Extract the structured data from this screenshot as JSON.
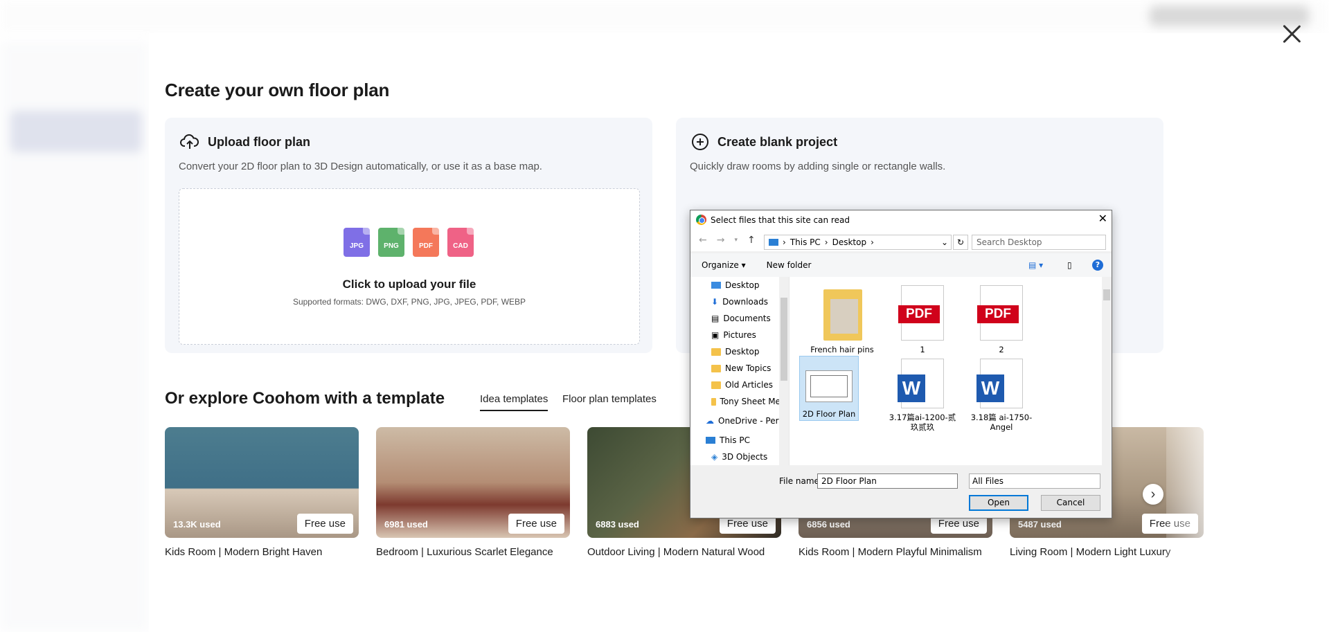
{
  "modal": {
    "title": "Create your own floor plan",
    "upload": {
      "heading": "Upload floor plan",
      "description": "Convert your 2D floor plan to 3D Design automatically, or use it as a base map.",
      "file_types": [
        "JPG",
        "PNG",
        "PDF",
        "CAD"
      ],
      "file_colors": [
        "#7f6fe6",
        "#5eb26c",
        "#f4785a",
        "#ef6286"
      ],
      "cta": "Click to upload your file",
      "formats": "Supported formats: DWG, DXF, PNG, JPG, JPEG, PDF, WEBP"
    },
    "blank": {
      "heading": "Create blank project",
      "description": "Quickly draw rooms by adding single or rectangle walls."
    },
    "explore": {
      "title": "Or explore Coohom with a template",
      "tabs": [
        "Idea templates",
        "Floor plan templates"
      ],
      "free_label": "Free use",
      "templates": [
        {
          "used": "13.3K used",
          "name": "Kids Room | Modern Bright Haven",
          "color": "#4d7d8f"
        },
        {
          "used": "6981 used",
          "name": "Bedroom | Luxurious Scarlet Elegance",
          "color": "#b48d74"
        },
        {
          "used": "6883 used",
          "name": "Outdoor Living | Modern Natural Wood",
          "color": "#5b6446"
        },
        {
          "used": "6856 used",
          "name": "Kids Room | Modern Playful Minimalism",
          "color": "#9a8b7c"
        },
        {
          "used": "5487 used",
          "name": "Living Room | Modern Light Luxury",
          "color": "#a89680"
        }
      ]
    }
  },
  "dialog": {
    "title": "Select files that this site can read",
    "breadcrumb": [
      "This PC",
      "Desktop"
    ],
    "search_placeholder": "Search Desktop",
    "organize": "Organize ▾",
    "new_folder": "New folder",
    "tree": [
      "Desktop",
      "Downloads",
      "Documents",
      "Pictures",
      "Desktop",
      "New Topics",
      "Old Articles",
      "Tony Sheet Meta",
      "OneDrive - Person",
      "This PC",
      "3D Objects"
    ],
    "files": [
      {
        "name": "French hair pins images",
        "kind": "folder"
      },
      {
        "name": "1",
        "kind": "pdf"
      },
      {
        "name": "2",
        "kind": "pdf"
      },
      {
        "name": "2D Floor Plan",
        "kind": "image"
      },
      {
        "name": "3.17篇ai-1200-贰玖贰玖",
        "kind": "doc"
      },
      {
        "name": "3.18篇 ai-1750-Angel",
        "kind": "doc"
      }
    ],
    "file_name_label": "File name:",
    "file_name_value": "2D Floor Plan",
    "file_type": "All Files",
    "open_label": "Open",
    "cancel_label": "Cancel",
    "pdf_badge": "PDF",
    "word_badge": "W"
  }
}
